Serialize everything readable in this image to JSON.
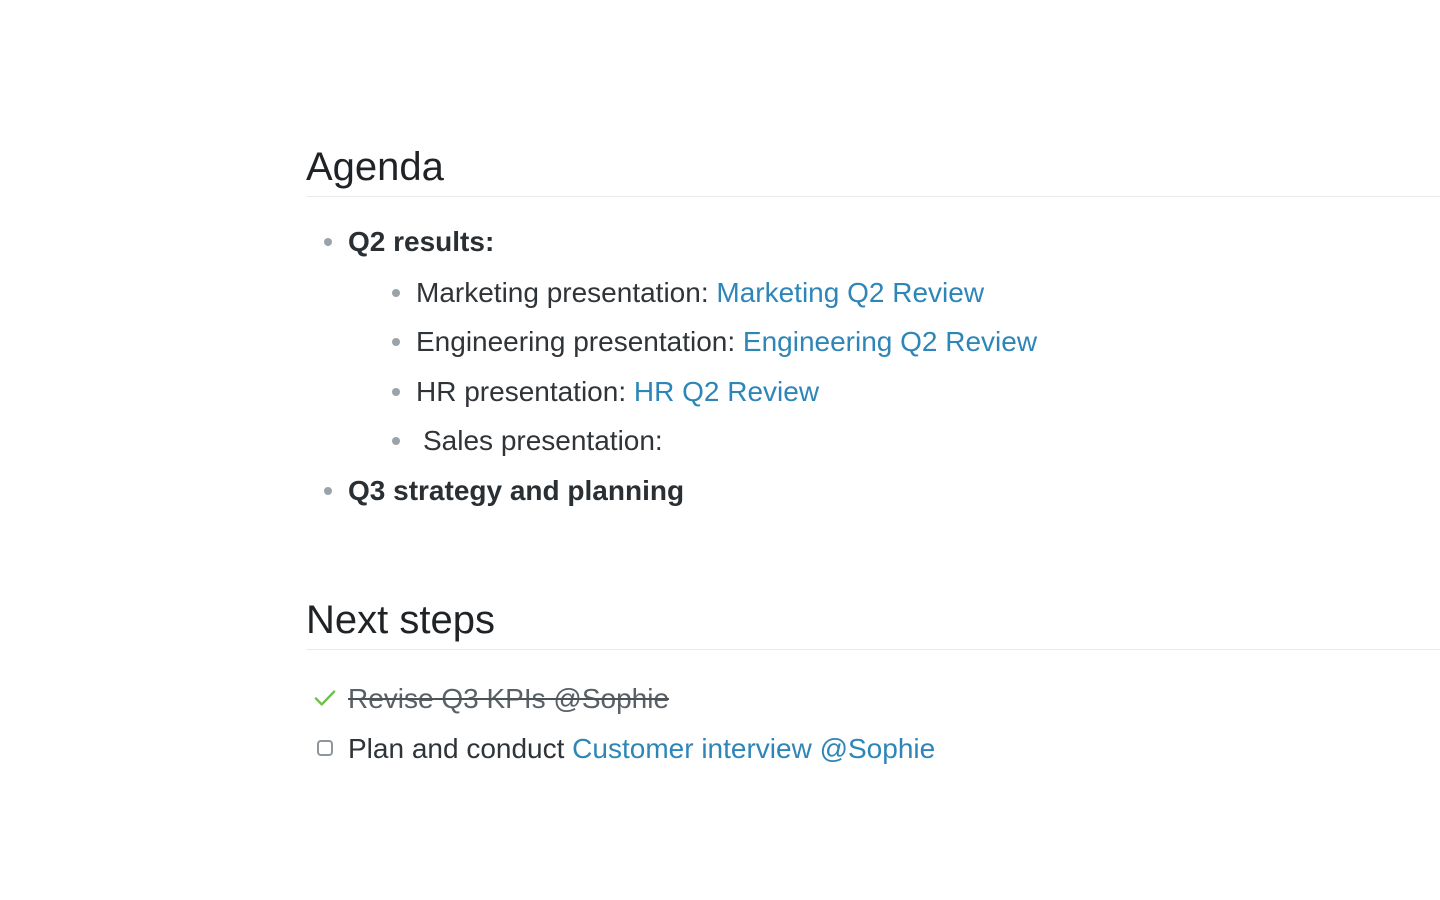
{
  "agenda": {
    "heading": "Agenda",
    "items": [
      {
        "label": "Q2 results:",
        "children": [
          {
            "text": "Marketing presentation: ",
            "link": "Marketing Q2 Review"
          },
          {
            "text": "Engineering presentation: ",
            "link": "Engineering Q2 Review"
          },
          {
            "text": "HR presentation: ",
            "link": "HR Q2 Review"
          },
          {
            "text": "Sales presentation:"
          }
        ]
      },
      {
        "label": "Q3 strategy and planning"
      }
    ]
  },
  "next_steps": {
    "heading": "Next steps",
    "tasks": [
      {
        "text": "Revise Q3 KPIs @Sophie",
        "done": true
      },
      {
        "text": "Plan and conduct ",
        "link": "Customer interview @Sophie",
        "done": false
      }
    ]
  },
  "colors": {
    "link": "#2e86b8",
    "check": "#6cc04a",
    "bullet": "#9aa3a8",
    "text": "#2f3438"
  },
  "icons": {
    "bullet": "bullet-dot",
    "done": "check-icon",
    "todo": "checkbox-icon"
  }
}
